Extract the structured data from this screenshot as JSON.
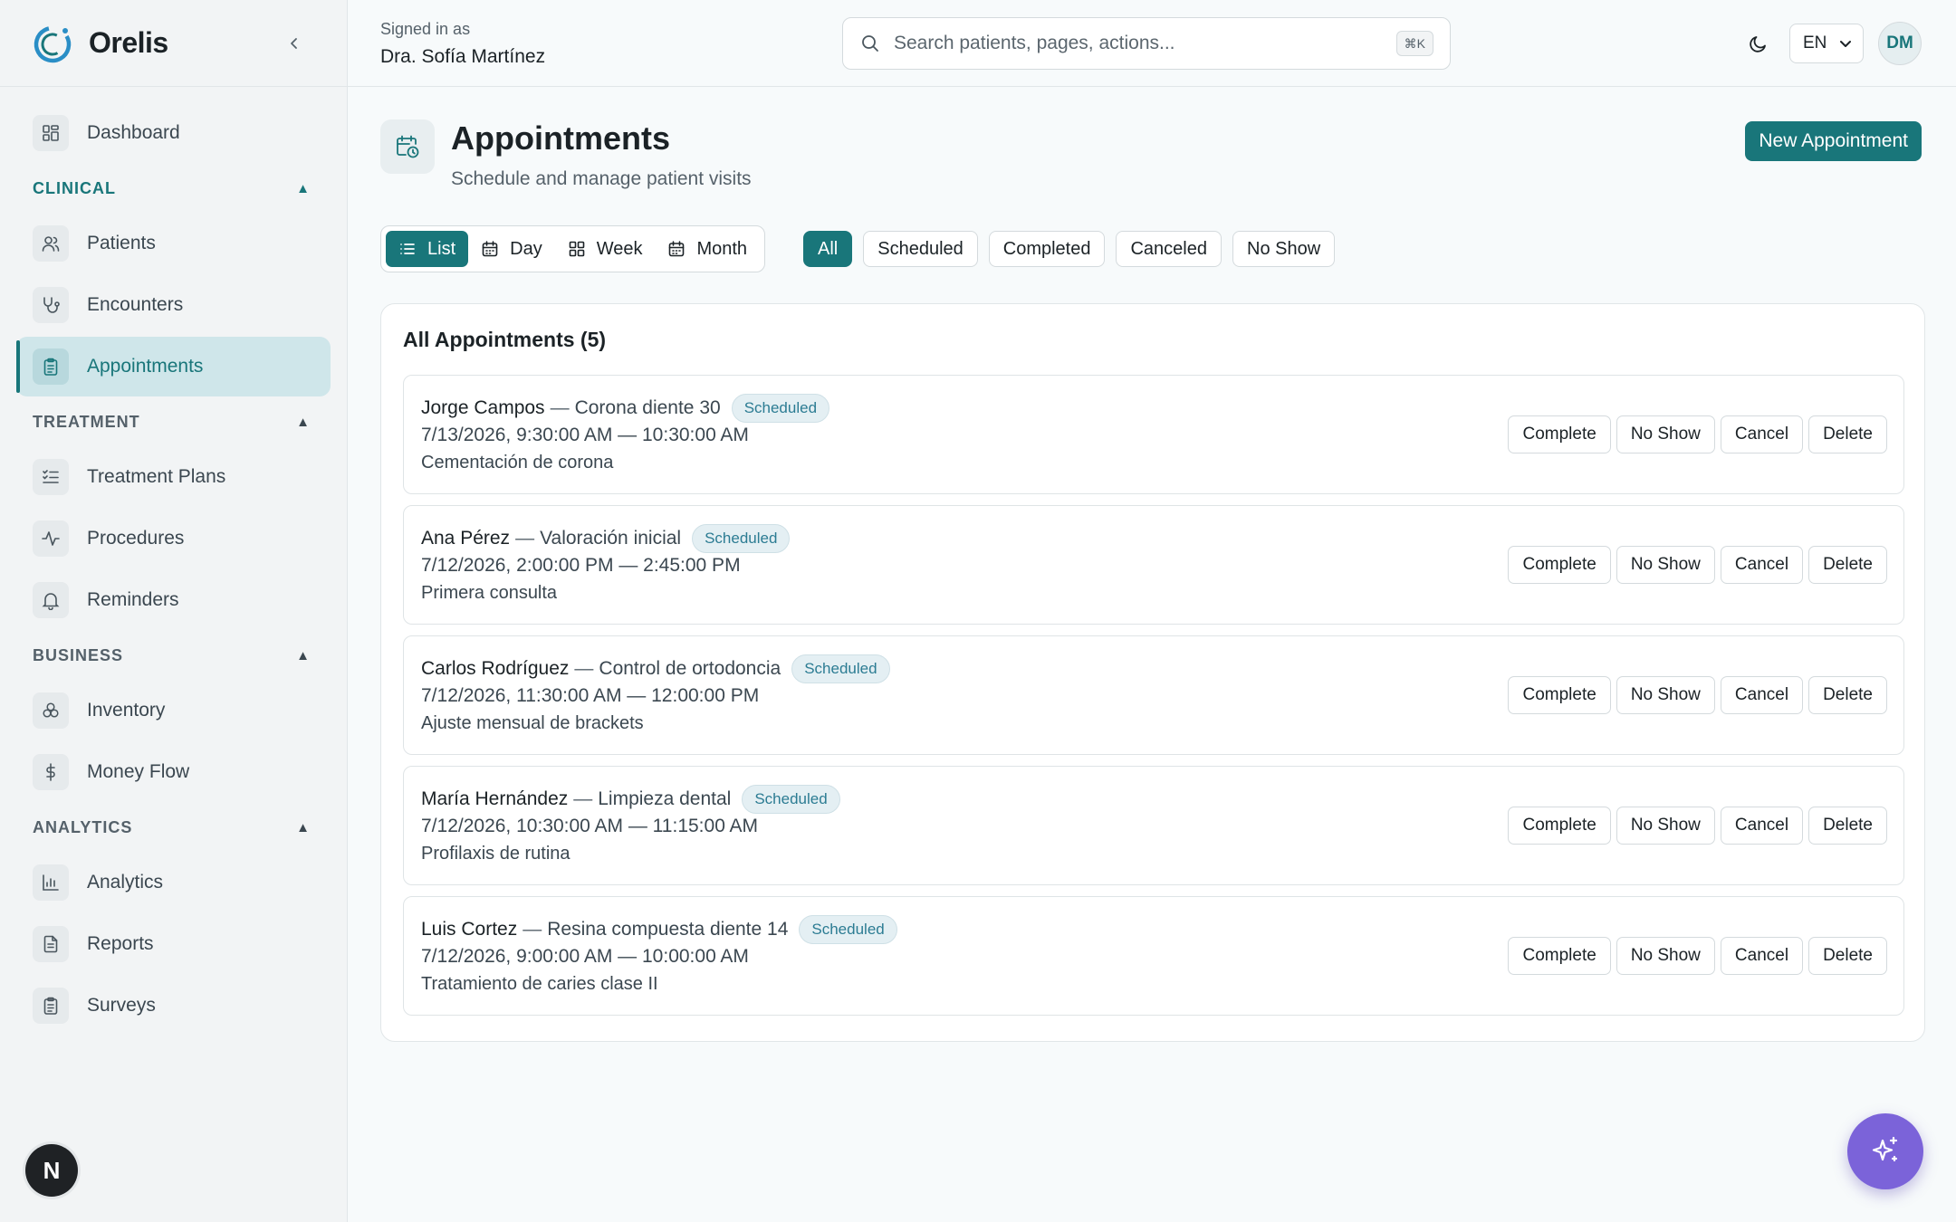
{
  "app": {
    "name": "Orelis",
    "accent": "#19767a",
    "fab_color": "#7b63d9"
  },
  "sidebar": {
    "top_item": {
      "label": "Dashboard",
      "icon": "grid-icon"
    },
    "sections": [
      {
        "title": "CLINICAL",
        "caret": "▲",
        "items": [
          {
            "label": "Patients",
            "icon": "users-icon"
          },
          {
            "label": "Encounters",
            "icon": "stethoscope-icon"
          },
          {
            "label": "Appointments",
            "icon": "clipboard-icon",
            "active": true
          }
        ]
      },
      {
        "title": "TREATMENT",
        "caret": "▲",
        "items": [
          {
            "label": "Treatment Plans",
            "icon": "list-checks-icon"
          },
          {
            "label": "Procedures",
            "icon": "activity-icon"
          },
          {
            "label": "Reminders",
            "icon": "bell-icon"
          }
        ]
      },
      {
        "title": "BUSINESS",
        "caret": "▲",
        "items": [
          {
            "label": "Inventory",
            "icon": "boxes-icon"
          },
          {
            "label": "Money Flow",
            "icon": "dollar-icon"
          }
        ]
      },
      {
        "title": "ANALYTICS",
        "caret": "▲",
        "items": [
          {
            "label": "Analytics",
            "icon": "bar-chart-icon"
          },
          {
            "label": "Reports",
            "icon": "file-text-icon"
          },
          {
            "label": "Surveys",
            "icon": "clipboard-list-icon"
          }
        ]
      }
    ],
    "footer_badge": "N"
  },
  "topbar": {
    "signed_in_caption": "Signed in as",
    "user_name": "Dra. Sofía Martínez",
    "search_placeholder": "Search patients, pages, actions...",
    "search_shortcut": "⌘K",
    "language": "EN",
    "avatar_initials": "DM"
  },
  "page": {
    "title": "Appointments",
    "subtitle": "Schedule and manage patient visits",
    "new_button": "New Appointment",
    "views": [
      {
        "label": "List",
        "icon": "list-icon",
        "active": true
      },
      {
        "label": "Day",
        "icon": "calendar-icon"
      },
      {
        "label": "Week",
        "icon": "grid-icon"
      },
      {
        "label": "Month",
        "icon": "calendar-icon"
      }
    ],
    "filters": [
      {
        "label": "All",
        "active": true
      },
      {
        "label": "Scheduled"
      },
      {
        "label": "Completed"
      },
      {
        "label": "Canceled"
      },
      {
        "label": "No Show"
      }
    ],
    "list_title": "All Appointments (5)",
    "separator": "—",
    "actions": [
      "Complete",
      "No Show",
      "Cancel",
      "Delete"
    ],
    "appointments": [
      {
        "patient": "Jorge Campos",
        "procedure": "Corona diente 30",
        "status": "Scheduled",
        "time": "7/13/2026, 9:30:00 AM — 10:30:00 AM",
        "note": "Cementación de corona"
      },
      {
        "patient": "Ana Pérez",
        "procedure": "Valoración inicial",
        "status": "Scheduled",
        "time": "7/12/2026, 2:00:00 PM — 2:45:00 PM",
        "note": "Primera consulta"
      },
      {
        "patient": "Carlos Rodríguez",
        "procedure": "Control de ortodoncia",
        "status": "Scheduled",
        "time": "7/12/2026, 11:30:00 AM — 12:00:00 PM",
        "note": "Ajuste mensual de brackets"
      },
      {
        "patient": "María Hernández",
        "procedure": "Limpieza dental",
        "status": "Scheduled",
        "time": "7/12/2026, 10:30:00 AM — 11:15:00 AM",
        "note": "Profilaxis de rutina"
      },
      {
        "patient": "Luis Cortez",
        "procedure": "Resina compuesta diente 14",
        "status": "Scheduled",
        "time": "7/12/2026, 9:00:00 AM — 10:00:00 AM",
        "note": "Tratamiento de caries clase II"
      }
    ]
  }
}
